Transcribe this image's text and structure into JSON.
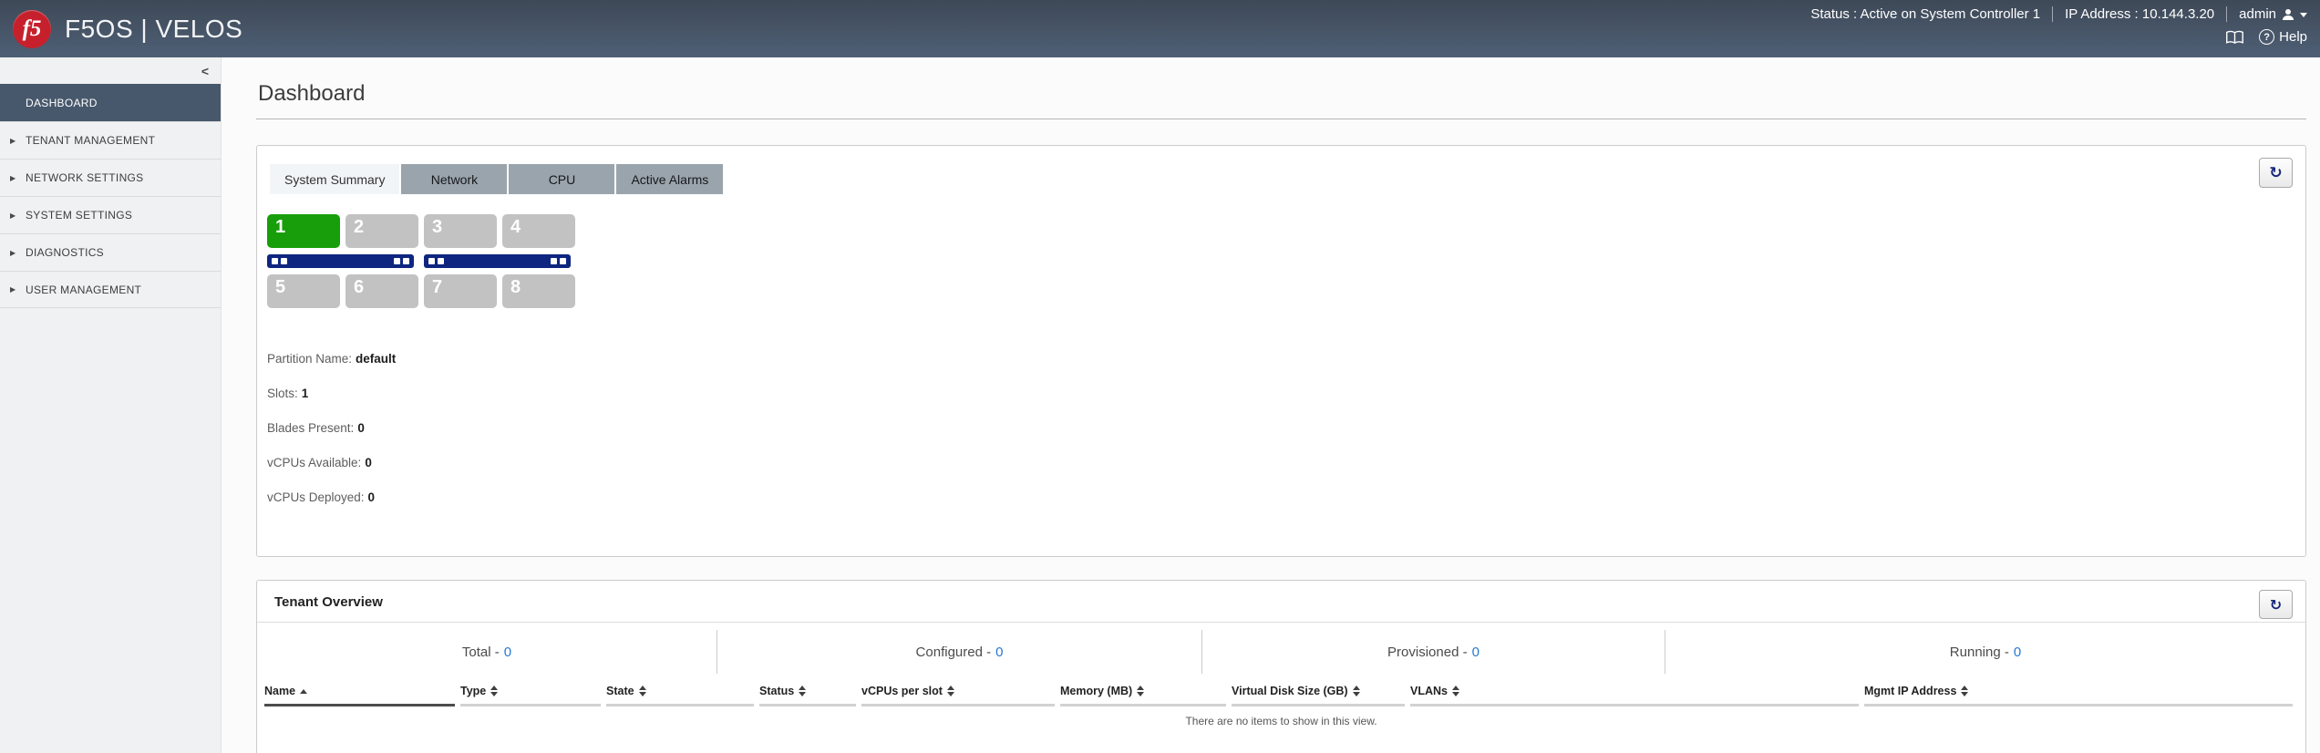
{
  "header": {
    "logo_text": "f5",
    "brand": "F5OS | VELOS",
    "status": "Status : Active on System Controller 1",
    "ip": "IP Address : 10.144.3.20",
    "user": "admin",
    "help": "Help"
  },
  "sidebar": {
    "collapse_icon": "<",
    "items": [
      {
        "label": "DASHBOARD",
        "active": true,
        "expandable": false
      },
      {
        "label": "TENANT MANAGEMENT",
        "active": false,
        "expandable": true
      },
      {
        "label": "NETWORK SETTINGS",
        "active": false,
        "expandable": true
      },
      {
        "label": "SYSTEM SETTINGS",
        "active": false,
        "expandable": true
      },
      {
        "label": "DIAGNOSTICS",
        "active": false,
        "expandable": true
      },
      {
        "label": "USER MANAGEMENT",
        "active": false,
        "expandable": true
      }
    ]
  },
  "page": {
    "title": "Dashboard"
  },
  "system_summary": {
    "tabs": [
      {
        "label": "System Summary",
        "active": true
      },
      {
        "label": "Network",
        "active": false
      },
      {
        "label": "CPU",
        "active": false
      },
      {
        "label": "Active Alarms",
        "active": false
      }
    ],
    "refresh_icon": "↻",
    "slots": [
      {
        "num": "1",
        "active": true
      },
      {
        "num": "2",
        "active": false
      },
      {
        "num": "3",
        "active": false
      },
      {
        "num": "4",
        "active": false
      },
      {
        "num": "5",
        "active": false
      },
      {
        "num": "6",
        "active": false
      },
      {
        "num": "7",
        "active": false
      },
      {
        "num": "8",
        "active": false
      }
    ],
    "info": [
      {
        "label": "Partition Name:",
        "value": "default"
      },
      {
        "label": "Slots:",
        "value": "1"
      },
      {
        "label": "Blades Present:",
        "value": "0"
      },
      {
        "label": "vCPUs Available:",
        "value": "0"
      },
      {
        "label": "vCPUs Deployed:",
        "value": "0"
      }
    ],
    "colors": {
      "slot_active": "#189e0b",
      "slot_empty": "#c2c2c2",
      "led_bar": "#0e2680"
    }
  },
  "tenant_overview": {
    "title": "Tenant Overview",
    "refresh_icon": "↻",
    "count_color": "#2878d0",
    "groups": [
      {
        "label": "Total -",
        "count": "0"
      },
      {
        "label": "Configured -",
        "count": "0"
      },
      {
        "label": "Provisioned -",
        "count": "0"
      },
      {
        "label": "Running -",
        "count": "0"
      }
    ],
    "columns": [
      {
        "label": "Name",
        "sort": "asc"
      },
      {
        "label": "Type",
        "sort": "both"
      },
      {
        "label": "State",
        "sort": "both"
      },
      {
        "label": "Status",
        "sort": "both"
      },
      {
        "label": "vCPUs per slot",
        "sort": "both"
      },
      {
        "label": "Memory (MB)",
        "sort": "both"
      },
      {
        "label": "Virtual Disk Size (GB)",
        "sort": "both"
      },
      {
        "label": "VLANs",
        "sort": "both"
      },
      {
        "label": "Mgmt IP Address",
        "sort": "both"
      }
    ],
    "rows": [],
    "empty_message": "There are no items to show in this view."
  }
}
